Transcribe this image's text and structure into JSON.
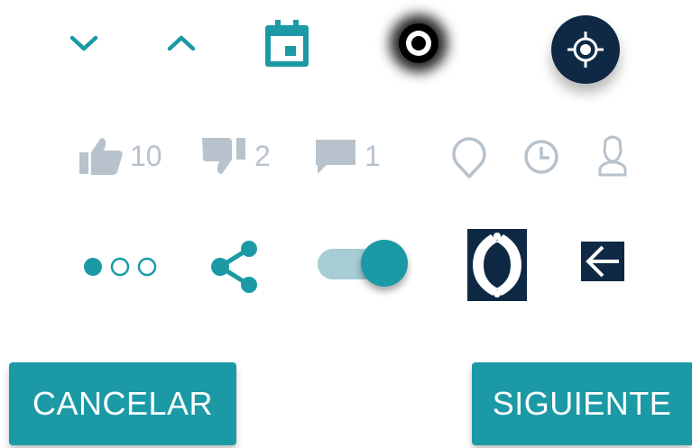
{
  "colors": {
    "accent": "#1b9aa6",
    "muted": "#b7c2cc",
    "dark_navy": "#0f2945"
  },
  "icons": [
    "chevron-down-icon",
    "chevron-up-icon",
    "calendar-icon",
    "radio-selected-icon",
    "locate-icon",
    "thumb-up-icon",
    "thumb-down-icon",
    "comment-icon",
    "location-pin-icon",
    "clock-icon",
    "user-icon",
    "page-dots-icon",
    "share-icon",
    "toggle-switch",
    "brand-logo",
    "back-arrow-icon"
  ],
  "stats": {
    "likes": "10",
    "dislikes": "2",
    "comments": "1"
  },
  "toggle": {
    "on": true
  },
  "pager": {
    "pages": 3,
    "current": 1
  },
  "buttons": {
    "cancel": "CANCELAR",
    "next": "SIGUIENTE"
  }
}
